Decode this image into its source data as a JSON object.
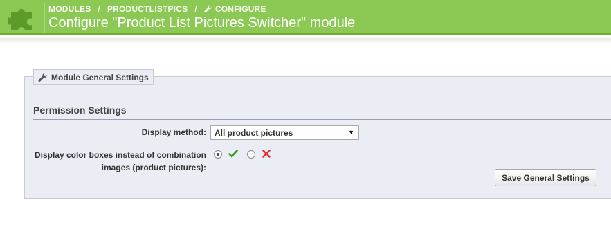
{
  "header": {
    "breadcrumb": [
      "MODULES",
      "PRODUCTLISTPICS",
      "CONFIGURE"
    ],
    "title": "Configure \"Product List Pictures Switcher\" module",
    "module_icon": "puzzle-icon",
    "breadcrumb_icon": "wrench-icon",
    "bg_color": "#8bc954"
  },
  "panel": {
    "legend": "Module General Settings",
    "legend_icon": "wrench-icon",
    "section_title": "Permission Settings",
    "display_method": {
      "label": "Display method:",
      "value": "All product pictures"
    },
    "color_boxes": {
      "label": "Display color boxes instead of combination images (product pictures):",
      "selected": "yes",
      "yes_icon": "check-icon",
      "no_icon": "cross-icon"
    },
    "save_button": "Save General Settings"
  }
}
